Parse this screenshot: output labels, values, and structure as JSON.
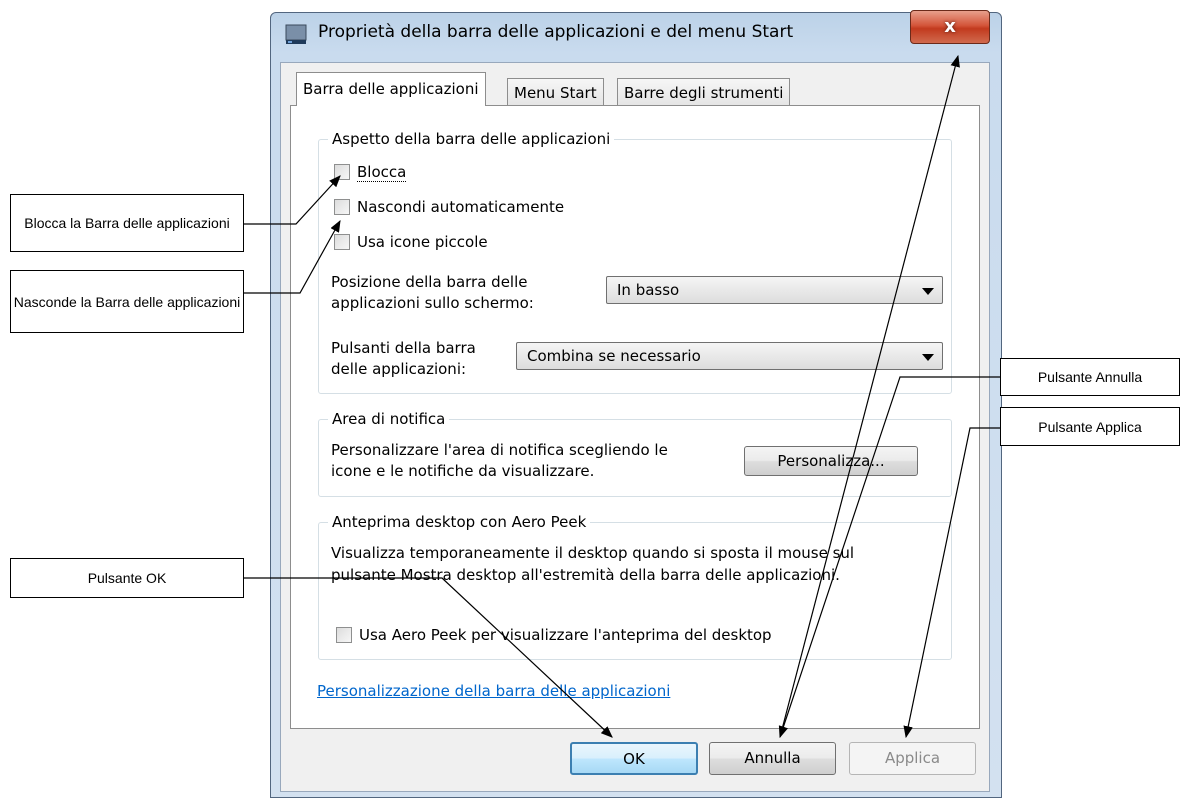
{
  "window": {
    "title": "Proprietà della barra delle applicazioni e del menu Start",
    "close_label": "x"
  },
  "tabs": [
    {
      "label": "Barra delle applicazioni",
      "active": true
    },
    {
      "label": "Menu Start",
      "active": false
    },
    {
      "label": "Barre degli strumenti",
      "active": false
    }
  ],
  "appearance": {
    "group_title": "Aspetto della barra delle applicazioni",
    "blocca": {
      "label": "Blocca",
      "checked": false
    },
    "nascondi": {
      "label": "Nascondi automaticamente",
      "checked": false
    },
    "icone": {
      "label": "Usa icone piccole",
      "checked": false
    },
    "posizione_label_1": "Posizione della barra delle",
    "posizione_label_2": "applicazioni sullo schermo:",
    "posizione_value": "In basso",
    "pulsanti_label_1": "Pulsanti della barra",
    "pulsanti_label_2": "delle applicazioni:",
    "pulsanti_value": "Combina se necessario"
  },
  "notification": {
    "group_title": "Area di notifica",
    "text_1": "Personalizzare l'area di notifica scegliendo le",
    "text_2": "icone e le notifiche da visualizzare.",
    "button": "Personalizza..."
  },
  "peek": {
    "group_title": "Anteprima desktop con Aero Peek",
    "text_1": "Visualizza temporaneamente il desktop quando si sposta il mouse sul",
    "text_2": "pulsante Mostra desktop all'estremità della barra delle applicazioni.",
    "checkbox": {
      "label": "Usa Aero Peek per visualizzare l'anteprima del desktop",
      "checked": false
    }
  },
  "link": "Personalizzazione della barra delle applicazioni",
  "buttons": {
    "ok": "OK",
    "annulla": "Annulla",
    "applica": "Applica"
  },
  "callouts": {
    "blocca": "Blocca la Barra  delle applicazioni",
    "nasconde": "Nasconde la Barra delle applicazioni",
    "ok": "Pulsante OK",
    "annulla": "Pulsante Annulla",
    "applica": "Pulsante Applica"
  },
  "colors": {
    "link": "#0066cc",
    "close_button": "#c23a1e",
    "title_bar": "#c9dbee"
  }
}
